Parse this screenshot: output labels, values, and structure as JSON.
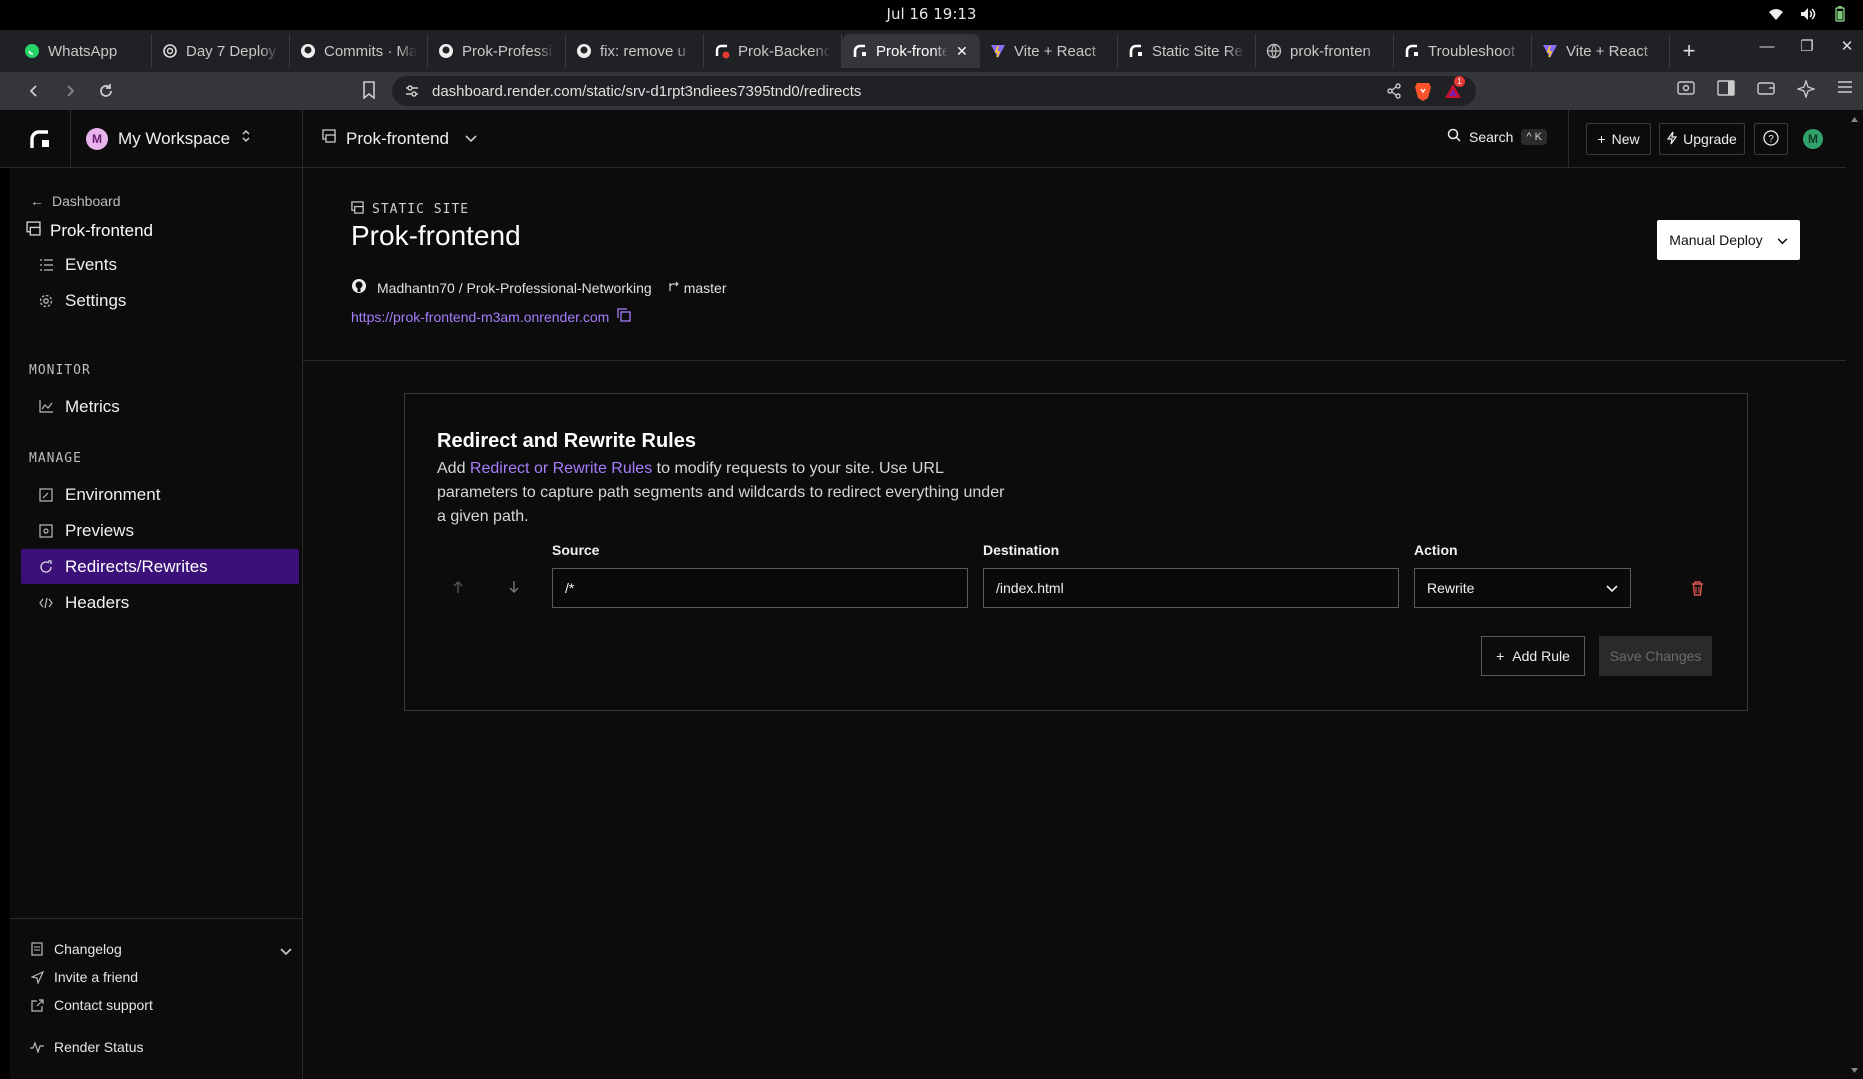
{
  "os": {
    "clock": "Jul 16  19:13"
  },
  "browser": {
    "tabs": [
      {
        "label": "WhatsApp",
        "icon": "whatsapp-icon"
      },
      {
        "label": "Day 7 Deploy",
        "icon": "openai-icon"
      },
      {
        "label": "Commits · Ma",
        "icon": "github-icon"
      },
      {
        "label": "Prok-Professi",
        "icon": "github-icon"
      },
      {
        "label": "fix: remove u",
        "icon": "github-icon"
      },
      {
        "label": "Prok-Backend",
        "icon": "render-error-icon"
      },
      {
        "label": "Prok-fronte",
        "icon": "render-icon",
        "active": true
      },
      {
        "label": "Vite + React",
        "icon": "vite-icon"
      },
      {
        "label": "Static Site Re",
        "icon": "render-icon"
      },
      {
        "label": "prok-fronten",
        "icon": "globe-icon"
      },
      {
        "label": "Troubleshoot",
        "icon": "render-icon"
      },
      {
        "label": "Vite + React",
        "icon": "vite-icon"
      }
    ],
    "url": "dashboard.render.com/static/srv-d1rpt3ndiees7395tnd0/redirects",
    "brave_badge": "1"
  },
  "header": {
    "workspace_initial": "M",
    "workspace": "My Workspace",
    "service": "Prok-frontend",
    "search_label": "Search",
    "search_shortcut": "^ K",
    "new_label": "New",
    "upgrade_label": "Upgrade",
    "user_initial": "M"
  },
  "sidebar": {
    "back_label": "Dashboard",
    "service": "Prok-frontend",
    "items_top": [
      {
        "label": "Events",
        "icon": "list-icon"
      },
      {
        "label": "Settings",
        "icon": "gear-icon"
      }
    ],
    "monitor_heading": "MONITOR",
    "monitor_items": [
      {
        "label": "Metrics",
        "icon": "chart-icon"
      }
    ],
    "manage_heading": "MANAGE",
    "manage_items": [
      {
        "label": "Environment",
        "icon": "env-icon"
      },
      {
        "label": "Previews",
        "icon": "preview-icon"
      },
      {
        "label": "Redirects/Rewrites",
        "icon": "redirect-icon",
        "active": true
      },
      {
        "label": "Headers",
        "icon": "code-icon"
      }
    ],
    "footer": [
      {
        "label": "Changelog",
        "icon": "doc-icon"
      },
      {
        "label": "Invite a friend",
        "icon": "send-icon"
      },
      {
        "label": "Contact support",
        "icon": "external-icon"
      },
      {
        "label": "Render Status",
        "icon": "pulse-icon"
      }
    ]
  },
  "main": {
    "service_type": "STATIC SITE",
    "title": "Prok-frontend",
    "repo": "Madhantn70 / Prok-Professional-Networking",
    "branch": "master",
    "site_url": "https://prok-frontend-m3am.onrender.com",
    "deploy_label": "Manual Deploy"
  },
  "rules_card": {
    "title": "Redirect and Rewrite Rules",
    "desc_prefix": "Add ",
    "desc_link": "Redirect or Rewrite Rules",
    "desc_suffix": " to modify requests to your site. Use URL parameters to capture path segments and wildcards to redirect everything under a given path.",
    "col_source": "Source",
    "col_destination": "Destination",
    "col_action": "Action",
    "rules": [
      {
        "source": "/*",
        "destination": "/index.html",
        "action": "Rewrite"
      }
    ],
    "add_rule_label": "Add Rule",
    "save_label": "Save Changes"
  },
  "colors": {
    "accent": "#a77dfb",
    "active_nav": "#3b1078",
    "delete": "#d9534f"
  }
}
